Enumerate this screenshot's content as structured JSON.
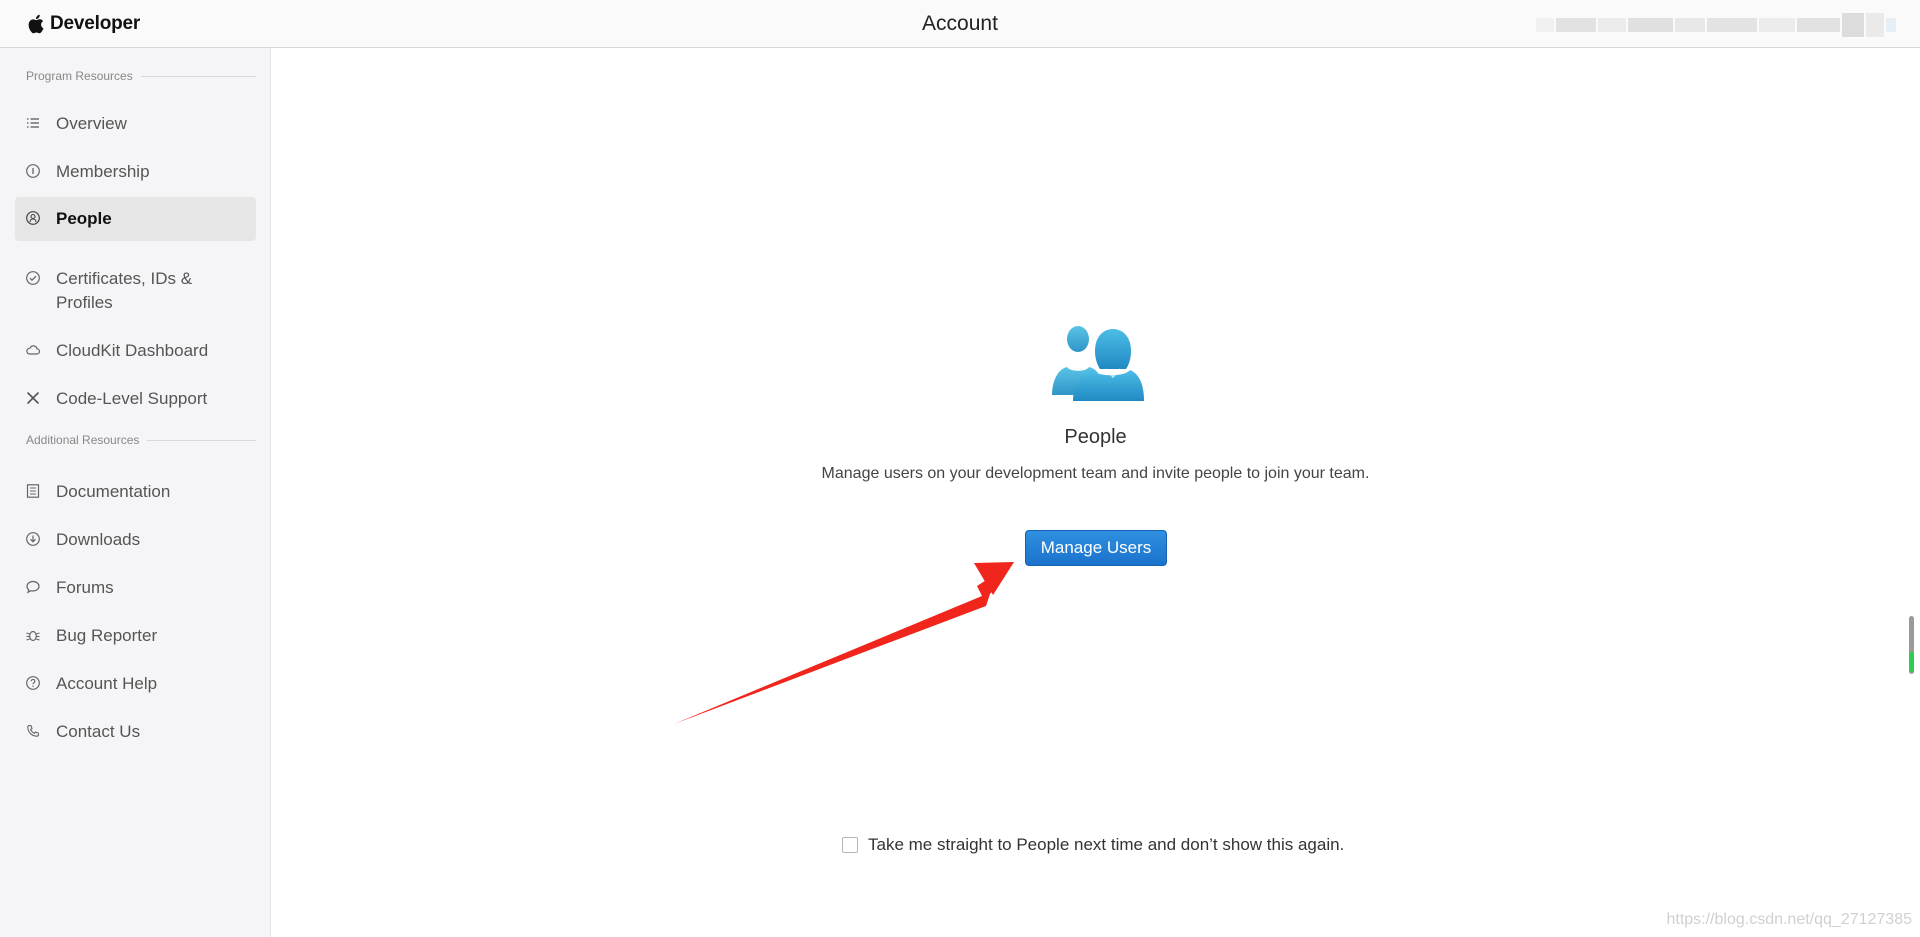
{
  "header": {
    "brand": "Developer",
    "title": "Account"
  },
  "sidebar": {
    "program_label": "Program Resources",
    "program_items": [
      {
        "label": "Overview",
        "icon": "list-icon"
      },
      {
        "label": "Membership",
        "icon": "info-circle-icon"
      },
      {
        "label": "People",
        "icon": "person-circle-icon",
        "active": true
      },
      {
        "label": "Certificates, IDs & Profiles",
        "icon": "checkmark-badge-icon"
      },
      {
        "label": "CloudKit Dashboard",
        "icon": "cloud-icon"
      },
      {
        "label": "Code-Level Support",
        "icon": "tools-icon"
      }
    ],
    "additional_label": "Additional Resources",
    "additional_items": [
      {
        "label": "Documentation",
        "icon": "document-icon"
      },
      {
        "label": "Downloads",
        "icon": "download-circle-icon"
      },
      {
        "label": "Forums",
        "icon": "speech-bubble-icon"
      },
      {
        "label": "Bug Reporter",
        "icon": "bug-icon"
      },
      {
        "label": "Account Help",
        "icon": "question-circle-icon"
      },
      {
        "label": "Contact Us",
        "icon": "phone-icon"
      }
    ]
  },
  "main": {
    "heading": "People",
    "description": "Manage users on your development team and invite people to join your team.",
    "button_label": "Manage Users",
    "skip_label": "Take me straight to People next time and don’t show this again.",
    "skip_checked": false
  },
  "colors": {
    "accent": "#1b73cc",
    "people_icon": "#3aaed8",
    "annotation_arrow": "#f0251c"
  },
  "watermark": "https://blog.csdn.net/qq_27127385"
}
